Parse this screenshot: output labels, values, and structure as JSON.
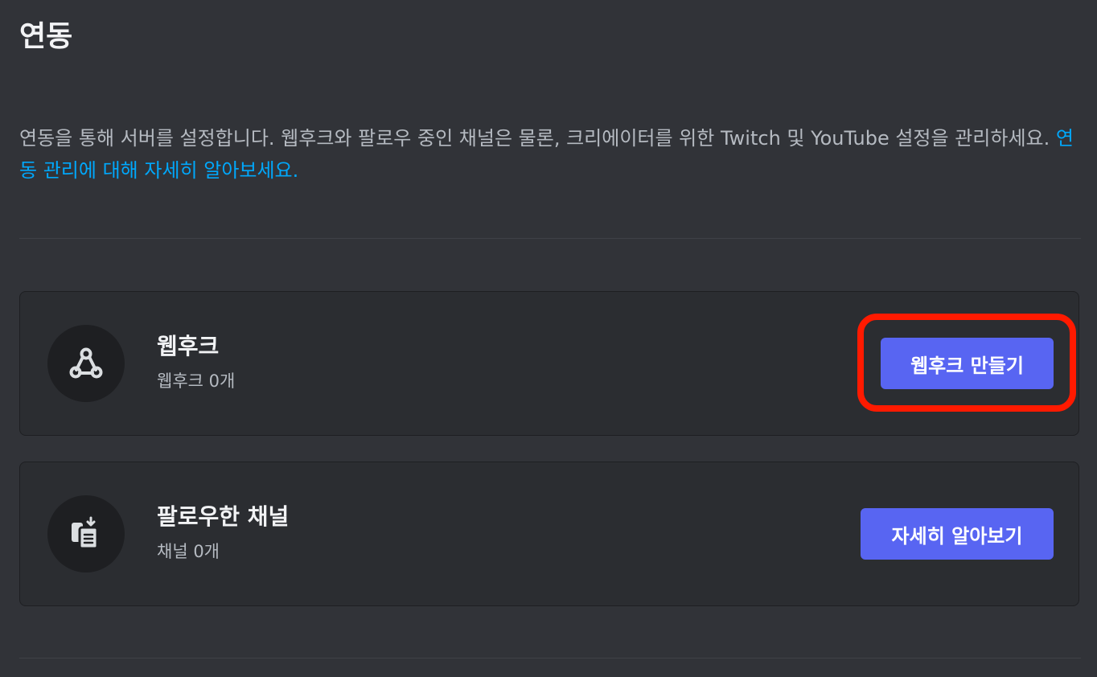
{
  "page": {
    "title": "연동",
    "description_text": "연동을 통해 서버를 설정합니다. 웹후크와 팔로우 중인 채널은 물론, 크리에이터를 위한 Twitch 및 YouTube 설정을 관리하세요. ",
    "description_link": "연동 관리에 대해 자세히 알아보세요."
  },
  "webhooks": {
    "icon": "webhook-icon",
    "title": "웹후크",
    "count_text": "웹후크 0개",
    "button_label": "웹후크 만들기"
  },
  "followed_channels": {
    "icon": "followed-channel-icon",
    "title": "팔로우한 채널",
    "count_text": "채널 0개",
    "button_label": "자세히 알아보기"
  },
  "colors": {
    "background": "#313338",
    "card": "#2b2d31",
    "accent": "#5865f2",
    "link": "#00a8fc",
    "highlight": "#ff1a00"
  }
}
